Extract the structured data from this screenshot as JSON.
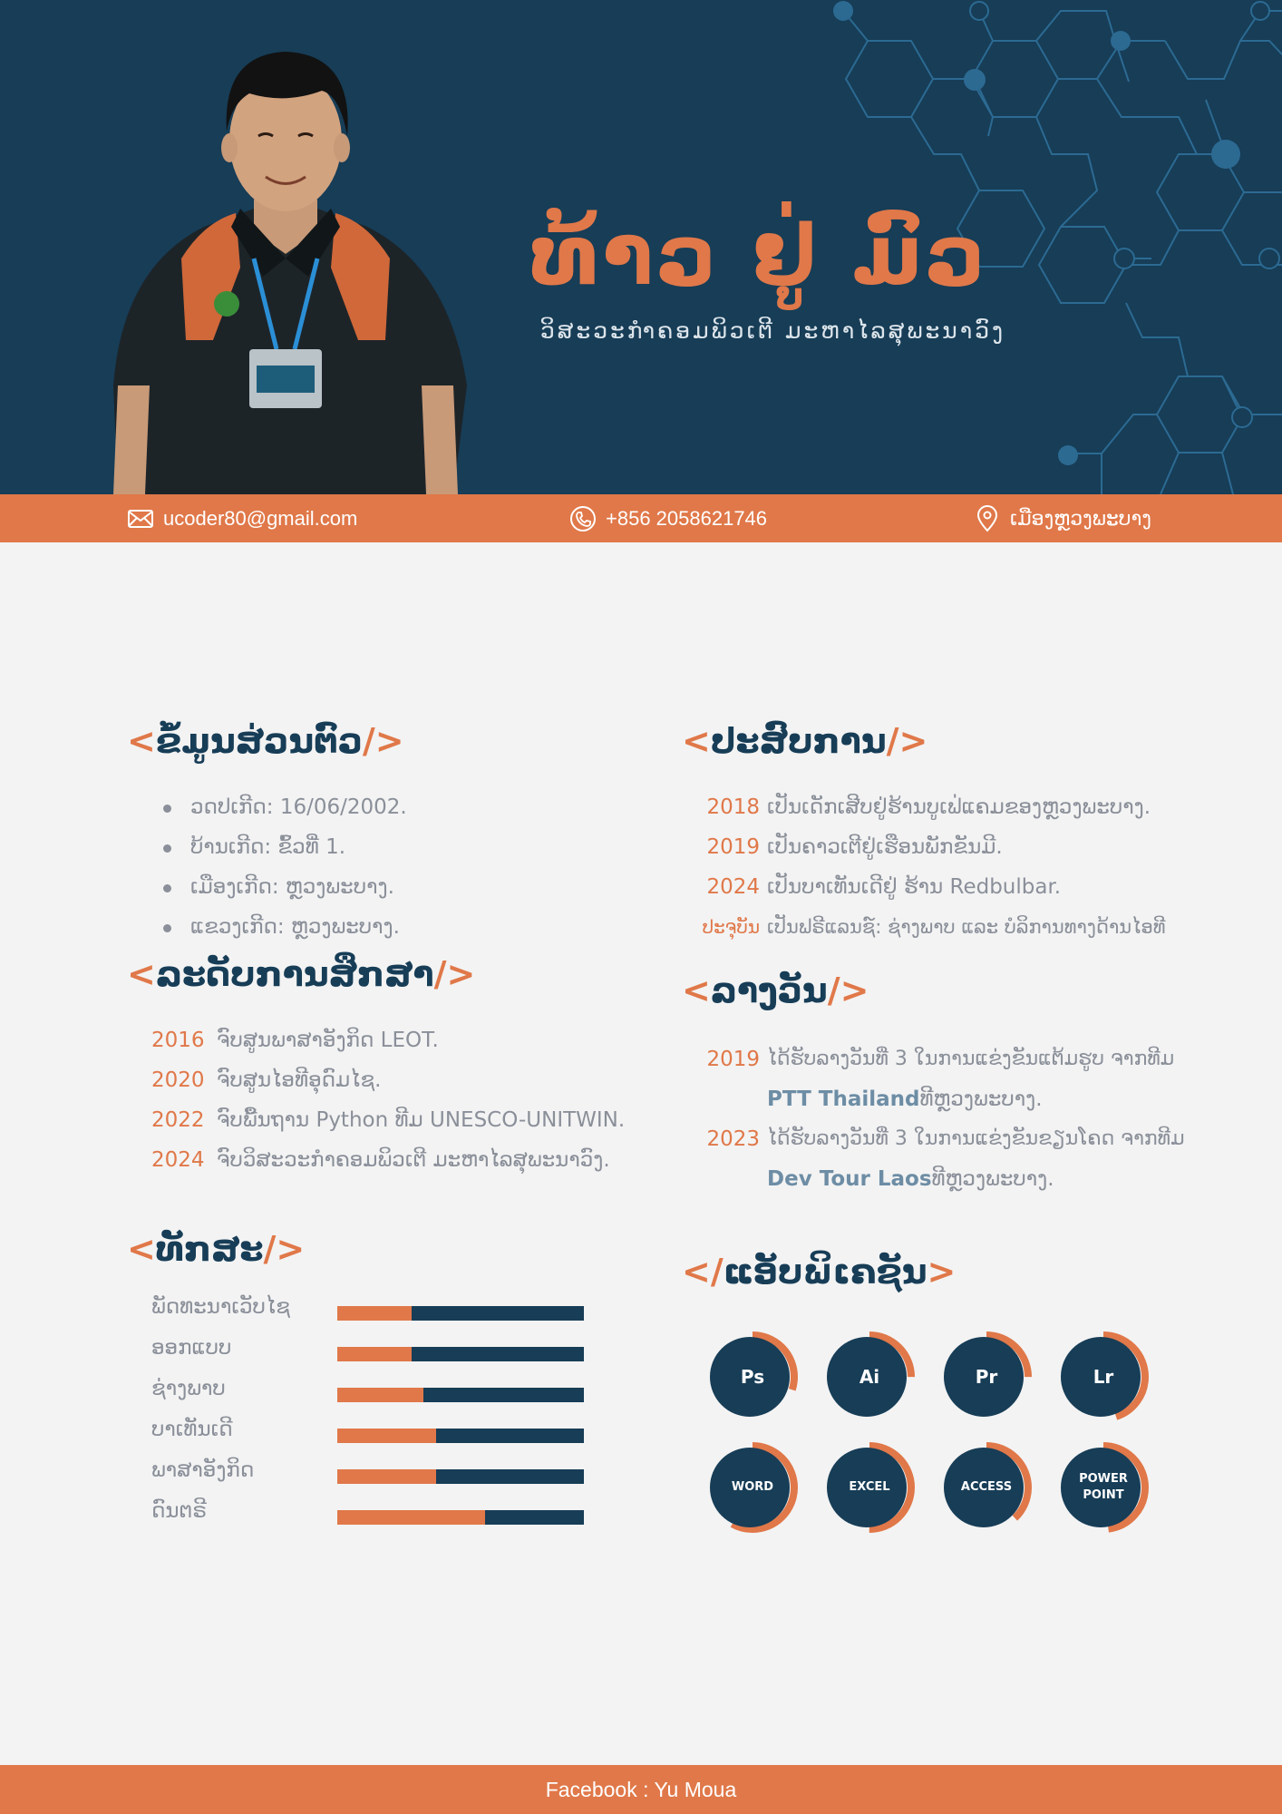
{
  "header": {
    "name": "ທ້າວ ຢູ່ ມົວ",
    "subtitle": "ວິສະວະກຳຄອມພິວເຕີ ມະຫາໄລສຸພະນາວົງ"
  },
  "contact": {
    "email": "ucoder80@gmail.com",
    "phone": "+856 2058621746",
    "location": "ເມືອງຫຼວງພະບາງ"
  },
  "personal": {
    "bracket_open": "<",
    "title": "ຂໍ້ມູນສ່ວນຕົວ",
    "bracket_close": "/>",
    "items": [
      "ວດປເກີດ:  16/06/2002.",
      "ບ້ານເກີດ: ຂົ້ວທີ່ 1.",
      "ເມືອງເກີດ: ຫຼວງພະບາງ.",
      "ແຂວງເກີດ: ຫຼວງພະບາງ."
    ]
  },
  "education": {
    "bracket_open": "<",
    "title": "ລະດັບການສຶກສາ",
    "bracket_close": "/>",
    "items": [
      {
        "year": "2016",
        "text": "ຈົບສູນພາສາອັງກິດ LEOT."
      },
      {
        "year": "2020",
        "text": "ຈົບສູນໄອທີອຸດົມໄຊ."
      },
      {
        "year": "2022",
        "text": "ຈົບພື້ນຖານ Python ທີມ UNESCO-UNITWIN."
      },
      {
        "year": "2024",
        "text": "ຈົບວິສະວະກຳຄອມພິວເຕີ ມະຫາໄລສຸພະນາວົງ."
      }
    ]
  },
  "skills": {
    "bracket_open": "<",
    "title": "ທັກສະ",
    "bracket_close": "/>",
    "items": [
      {
        "label": "ພັດທະນາເວັບໄຊ",
        "level": 0.3
      },
      {
        "label": "ອອກແບບ",
        "level": 0.3
      },
      {
        "label": "ຊ່າງພາບ",
        "level": 0.35
      },
      {
        "label": "ບາເທັນເດີ",
        "level": 0.4
      },
      {
        "label": "ພາສາອັງກິດ",
        "level": 0.4
      },
      {
        "label": "ດົນຕຣີ",
        "level": 0.6
      }
    ]
  },
  "experience": {
    "bracket_open": "<",
    "title": "ປະສົບການ",
    "bracket_close": "/>",
    "items": [
      {
        "year": "2018",
        "text": "ເປັນເດັກເສີບຢູ່ຮ້ານບູເຟ່ແຄມຂອງຫຼວງພະບາງ."
      },
      {
        "year": "2019",
        "text": "ເປັນຄາວເຕີຢູ່ເຮືອນພັກຂັນມີ."
      },
      {
        "year": "2024",
        "text": "ເປັນບາເທັນເດີຢູ່ ຮ້ານ Redbulbar."
      },
      {
        "year": "ປະຈຸບັນ",
        "text": "ເປັນຟຣີແລນຊ໌: ຊ່າງພາບ ແລະ ບໍລິການທາງດ້ານໄອທີ"
      }
    ]
  },
  "awards": {
    "bracket_open": "<",
    "title": "ລາງວັນ",
    "bracket_close": "/>",
    "items": [
      {
        "year": "2019",
        "line1": "ໄດ້ຮັບລາງວັນທີ່  3 ໃນການແຂ່ງຂັນແຕ້ມຮູບ ຈາກທີມ",
        "team": "PTT Thailand",
        "line2": " ທີຫຼວງພະບາງ."
      },
      {
        "year": "2023",
        "line1": "ໄດ້ຮັບລາງວັນທີ່ 3 ໃນການແຂ່ງຂັນຂຽນໂຄດ ຈາກທີມ",
        "team": "Dev Tour Laos",
        "line2": " ທີຫຼວງພະບາງ."
      }
    ]
  },
  "apps": {
    "bracket_open": "</",
    "title": "ແອັບພິເຄຊັນ",
    "bracket_close": ">",
    "items": [
      {
        "label": "Ps",
        "level": 0.3
      },
      {
        "label": "Ai",
        "level": 0.25
      },
      {
        "label": "Pr",
        "level": 0.25
      },
      {
        "label": "Lr",
        "level": 0.45
      },
      {
        "label": "WORD",
        "level": 0.58
      },
      {
        "label": "EXCEL",
        "level": 0.5
      },
      {
        "label": "ACCESS",
        "level": 0.38
      },
      {
        "label": "POWER POINT",
        "level": 0.48
      }
    ]
  },
  "colors": {
    "navy": "#173d57",
    "orange": "#e07849",
    "background": "#f3f3f3"
  },
  "footer": {
    "text": "Facebook : Yu Moua"
  }
}
